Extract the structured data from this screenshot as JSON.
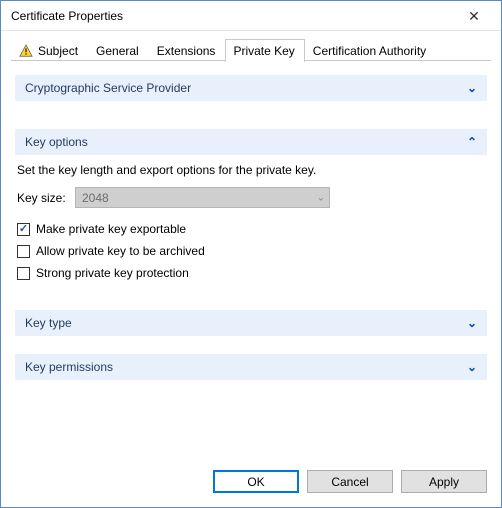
{
  "window": {
    "title": "Certificate Properties"
  },
  "tabs": {
    "subject": "Subject",
    "general": "General",
    "extensions": "Extensions",
    "private_key": "Private Key",
    "cert_auth": "Certification Authority",
    "active": "private_key"
  },
  "groups": {
    "csp": {
      "title": "Cryptographic Service Provider"
    },
    "key_options": {
      "title": "Key options",
      "desc": "Set the key length and export options for the private key.",
      "keysize_label": "Key size:",
      "keysize_value": "2048",
      "exportable_label": "Make private key exportable",
      "exportable_checked": true,
      "archive_label": "Allow private key to be archived",
      "archive_checked": false,
      "strong_label": "Strong private key protection",
      "strong_checked": false
    },
    "key_type": {
      "title": "Key type"
    },
    "key_permissions": {
      "title": "Key permissions"
    }
  },
  "buttons": {
    "ok": "OK",
    "cancel": "Cancel",
    "apply": "Apply"
  }
}
